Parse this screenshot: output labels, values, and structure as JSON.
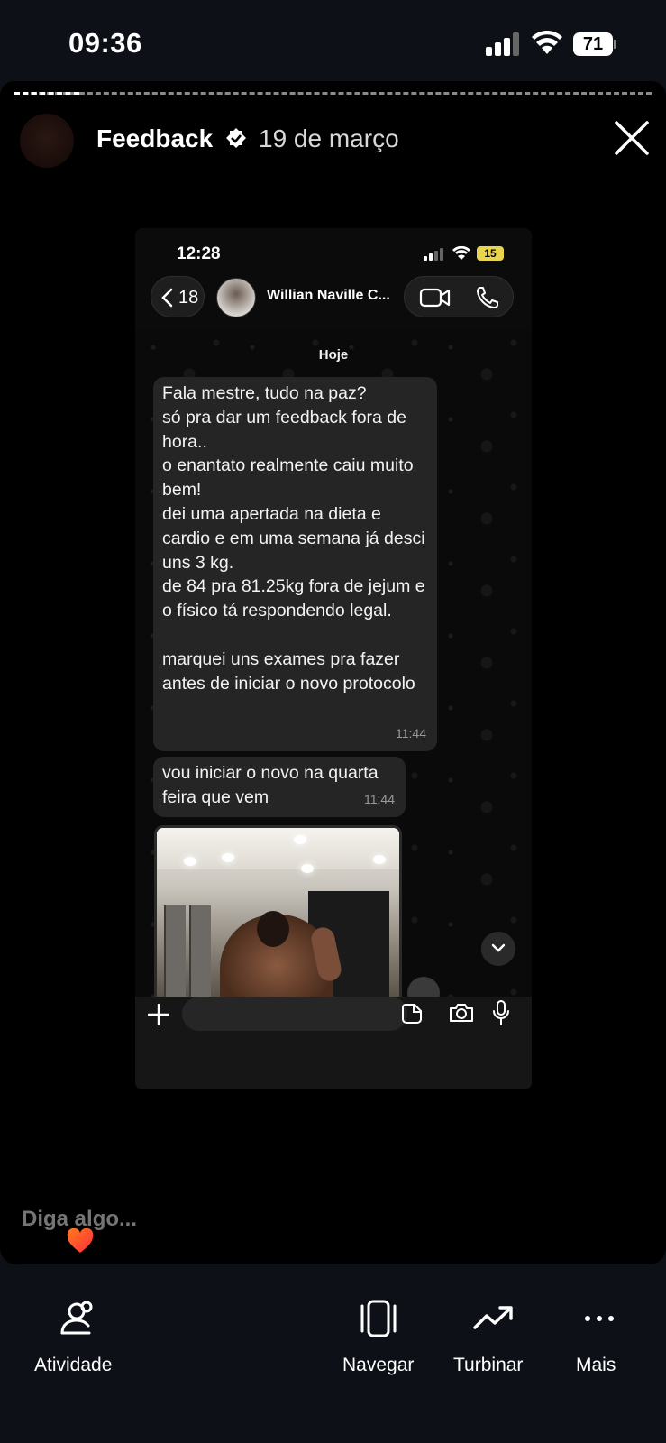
{
  "status_bar": {
    "time": "09:36",
    "battery": "71"
  },
  "story": {
    "title": "Feedback",
    "date": "19 de março",
    "reply_placeholder": "Diga algo..."
  },
  "chat_screenshot": {
    "time": "12:28",
    "battery": "15",
    "back_count": "18",
    "contact_name": "Willian Naville C...",
    "day_label": "Hoje",
    "messages": [
      {
        "text": "Fala mestre, tudo na paz?\nsó pra dar um feedback fora de hora..\no enantato realmente caiu muito bem!\ndei uma apertada na dieta e cardio e em uma semana já desci uns 3 kg.\nde 84 pra 81.25kg fora de jejum e o físico tá respondendo legal.\n\nmarquei uns exames pra fazer antes de iniciar o novo protocolo",
        "time": "11:44"
      },
      {
        "text": "vou iniciar o novo na quarta feira que vem",
        "time": "11:44"
      }
    ]
  },
  "bottom_nav": [
    {
      "label": "Atividade",
      "icon": "activity-icon"
    },
    {
      "label": "Navegar",
      "icon": "browse-icon"
    },
    {
      "label": "Turbinar",
      "icon": "boost-icon"
    },
    {
      "label": "Mais",
      "icon": "more-icon"
    }
  ],
  "colors": {
    "background": "#0d1117",
    "story_bg": "#000000",
    "bubble": "#252525",
    "battery_low": "#e8d44d"
  }
}
